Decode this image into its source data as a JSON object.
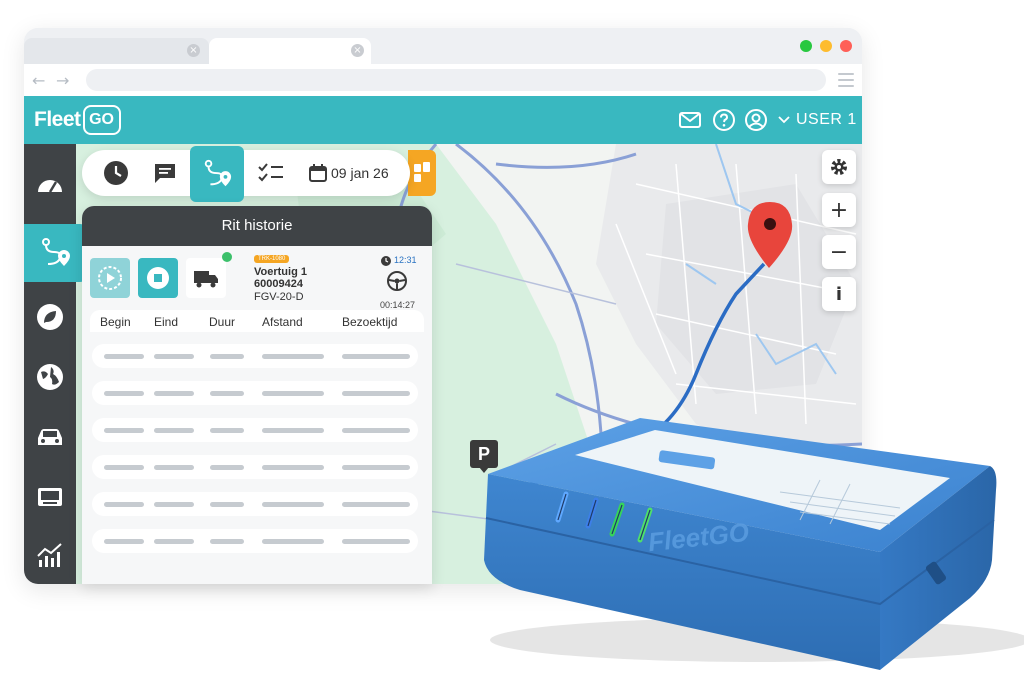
{
  "browser": {
    "tab_close_glyph": "×",
    "traffic_colors": [
      "#28c840",
      "#febc2e",
      "#ff5f57"
    ],
    "back_glyph": "←",
    "forward_glyph": "→"
  },
  "header": {
    "logo_text": "Fleet",
    "logo_box_text": "GO",
    "user_label": "USER 1",
    "accent_color": "#39b8c0",
    "icons": [
      "mail-icon",
      "help-icon",
      "user-icon",
      "chevron-down-icon"
    ]
  },
  "sidebar": {
    "items": [
      {
        "icon": "dashboard-icon",
        "active": false
      },
      {
        "icon": "route-icon",
        "active": true
      },
      {
        "icon": "leaf-icon",
        "active": false
      },
      {
        "icon": "globe-icon",
        "active": false
      },
      {
        "icon": "car-icon",
        "active": false
      },
      {
        "icon": "device-icon",
        "active": false
      },
      {
        "icon": "chart-icon",
        "active": false
      }
    ]
  },
  "toolbar": {
    "date_label": "09 jan 26",
    "buttons": [
      "clock-icon",
      "chat-icon",
      "route-icon",
      "checklist-icon",
      "calendar-icon"
    ]
  },
  "panel": {
    "title": "Rit historie",
    "vehicle": {
      "badge": "TRK-1080",
      "name": "Voertuig 1",
      "id": "60009424",
      "plate": "FGV-20-D",
      "time": "12:31",
      "duration": "00:14:27"
    },
    "columns": [
      "Begin",
      "Eind",
      "Duur",
      "Afstand",
      "Bezoektijd"
    ],
    "row_count": 6
  },
  "map": {
    "controls": [
      "settings-icon",
      "zoom-in",
      "zoom-out",
      "info"
    ],
    "zoom_in_glyph": "+",
    "zoom_out_glyph": "−",
    "info_glyph": "i",
    "parking_label": "P"
  },
  "device": {
    "label": "FleetGO"
  }
}
